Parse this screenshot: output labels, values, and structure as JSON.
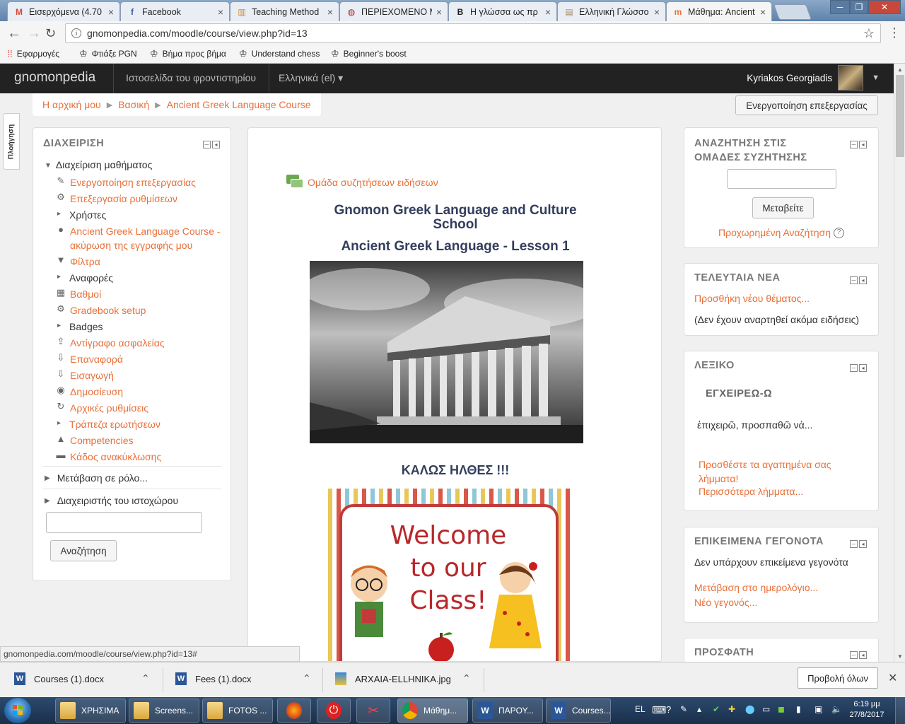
{
  "tabs": [
    {
      "label": "Εισερχόμενα (4.70",
      "icon": "M",
      "color": "#d44638"
    },
    {
      "label": "Facebook",
      "icon": "f",
      "color": "#3b5998"
    },
    {
      "label": "Teaching Method",
      "icon": "▥",
      "color": "#d08a2c"
    },
    {
      "label": "ΠΕΡΙΕΧΟΜΕΝΟ Μ",
      "icon": "◍",
      "color": "#b22"
    },
    {
      "label": "Η γλώσσα ως πρ",
      "icon": "B",
      "color": "#222"
    },
    {
      "label": "Ελληνική Γλώσσο",
      "icon": "▤",
      "color": "#a86"
    },
    {
      "label": "Μάθημα: Ancient",
      "icon": "m",
      "color": "#e8703a"
    }
  ],
  "browser": {
    "url": "gnomonpedia.com/moodle/course/view.php?id=13",
    "bookmarks": [
      "Εφαρμογές",
      "Φτιάξε PGN",
      "Βήμα προς βήμα",
      "Understand chess",
      "Beginner's boost"
    ]
  },
  "navbar": {
    "brand": "gnomonpedia",
    "link1": "Ιστοσελίδα του φροντιστηρίου",
    "language": "Ελληνικά (el) ▾",
    "user": "Kyriakos Georgiadis"
  },
  "breadcrumb": [
    "Η αρχική μου",
    "Βασική",
    "Ancient Greek Language Course"
  ],
  "edit_button": "Ενεργοποίηση επεξεργασίας",
  "sidetab": "Πλοήγηση",
  "admin": {
    "title": "ΔΙΑΧΕΙΡΙΣΗ",
    "course_admin": "Διαχείριση μαθήματος",
    "items": [
      {
        "label": "Ενεργοποίηση επεξεργασίας",
        "icon": "✎",
        "link": true
      },
      {
        "label": "Επεξεργασία ρυθμίσεων",
        "icon": "⚙",
        "link": true
      },
      {
        "label": "Χρήστες",
        "icon": "▸",
        "link": false
      },
      {
        "label": "Ancient Greek Language Course -",
        "label2": "ακύρωση της εγγραφής μου",
        "icon": "●",
        "link": true
      },
      {
        "label": "Φίλτρα",
        "icon": "▼",
        "link": true
      },
      {
        "label": "Αναφορές",
        "icon": "▸",
        "link": false
      },
      {
        "label": "Βαθμοί",
        "icon": "▦",
        "link": true
      },
      {
        "label": "Gradebook setup",
        "icon": "⚙",
        "link": true
      },
      {
        "label": "Badges",
        "icon": "▸",
        "link": false
      },
      {
        "label": "Αντίγραφο ασφαλείας",
        "icon": "⇪",
        "link": true
      },
      {
        "label": "Επαναφορά",
        "icon": "⇩",
        "link": true
      },
      {
        "label": "Εισαγωγή",
        "icon": "⇩",
        "link": true
      },
      {
        "label": "Δημοσίευση",
        "icon": "◉",
        "link": true
      },
      {
        "label": "Αρχικές ρυθμίσεις",
        "icon": "↻",
        "link": true
      },
      {
        "label": "Τράπεζα ερωτήσεων",
        "icon": "▸",
        "link": true
      },
      {
        "label": "Competencies",
        "icon": "▲",
        "link": true
      },
      {
        "label": "Κάδος ανακύκλωσης",
        "icon": "▬",
        "link": true
      }
    ],
    "switch_role": "Μετάβαση σε ρόλο...",
    "site_admin": "Διαχειριστής του ιστοχώρου",
    "search_button": "Αναζήτηση"
  },
  "main": {
    "forum": "Ομάδα συζητήσεων ειδήσεων",
    "title1": "Gnomon Greek Language and Culture",
    "title1b": "School",
    "title2": "Ancient Greek Language - Lesson 1",
    "welcome_heading": "ΚΑΛΩΣ ΗΛΘΕΣ !!!",
    "welcome_line1": "Welcome",
    "welcome_line2": "to our",
    "welcome_line3": "Class!"
  },
  "search_forums": {
    "title1": "ΑΝΑΖΗΤΗΣΗ ΣΤΙΣ",
    "title2": "ΟΜΑΔΕΣ ΣΥΖΗΤΗΣΗΣ",
    "button": "Μεταβείτε",
    "advanced": "Προχωρημένη Αναζήτηση"
  },
  "news": {
    "title": "ΤΕΛΕΥΤΑΙΑ ΝΕΑ",
    "add": "Προσθήκη νέου θέματος...",
    "none": "(Δεν έχουν αναρτηθεί ακόμα ειδήσεις)"
  },
  "glossary": {
    "title": "ΛΕΞΙΚΟ",
    "word": "ΕΓΧΕΙΡΕΩ-Ω",
    "definition": "ἐπιχειρῶ, προσπαθῶ νά...",
    "add1": "Προσθέστε τα αγαπημένα σας",
    "add2": "λήμματα!",
    "more": "Περισσότερα λήμματα..."
  },
  "events": {
    "title": "ΕΠΙΚΕΙΜΕΝΑ ΓΕΓΟΝΟΤΑ",
    "none": "Δεν υπάρχουν επικείμενα γεγονότα",
    "calendar": "Μετάβαση στο ημερολόγιο...",
    "new": "Νέο γεγονός..."
  },
  "recent": {
    "title": "ΠΡΟΣΦΑΤΗ"
  },
  "status_url": "gnomonpedia.com/moodle/course/view.php?id=13#",
  "downloads": [
    "Courses (1).docx",
    "Fees (1).docx",
    "ARXAIA-ELLHNIKA.jpg"
  ],
  "show_all": "Προβολή όλων",
  "taskbar": {
    "items": [
      "ΧΡΗΣΙΜΑ",
      "Screens...",
      "FOTOS ...",
      "Μάθημ...",
      "ΠΑΡΟΥ...",
      "Courses..."
    ],
    "lang": "EL",
    "time": "6:19 μμ",
    "date": "27/8/2017"
  }
}
